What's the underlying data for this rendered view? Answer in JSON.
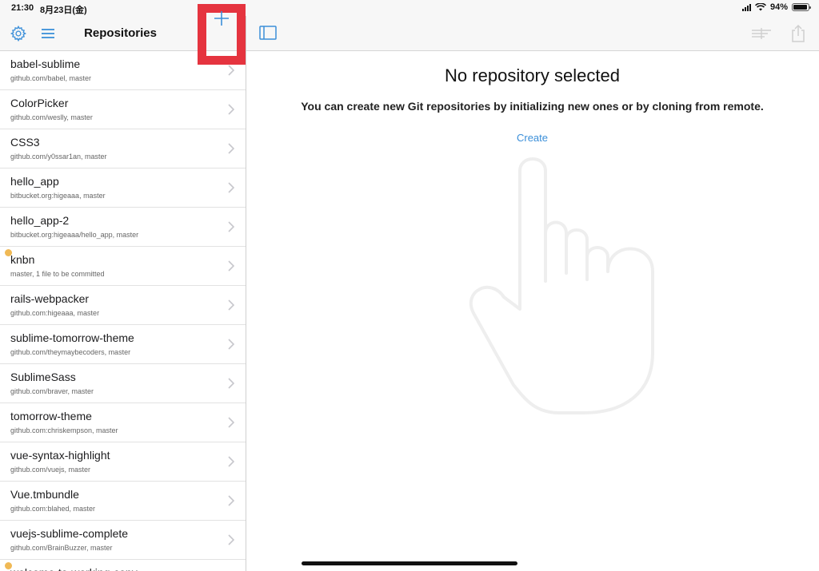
{
  "status_bar": {
    "time": "21:30",
    "date": "8月23日(金)",
    "battery": "94%",
    "battery_level": 0.94
  },
  "left_toolbar": {
    "title": "Repositories",
    "settings_icon": "gear-icon",
    "menu_icon": "menu-icon",
    "add_icon": "plus-icon"
  },
  "right_toolbar": {
    "sidebar_icon": "sidebar-toggle-icon",
    "filter_icon": "filter-icon",
    "share_icon": "share-icon"
  },
  "repositories": [
    {
      "name": "babel-sublime",
      "detail": "github.com/babel, master",
      "modified": false
    },
    {
      "name": "ColorPicker",
      "detail": "github.com/weslly, master",
      "modified": false
    },
    {
      "name": "CSS3",
      "detail": "github.com/y0ssar1an, master",
      "modified": false
    },
    {
      "name": "hello_app",
      "detail": "bitbucket.org:higeaaa, master",
      "modified": false
    },
    {
      "name": "hello_app-2",
      "detail": "bitbucket.org:higeaaa/hello_app, master",
      "modified": false
    },
    {
      "name": "knbn",
      "detail": "master, 1 file to be committed",
      "modified": true
    },
    {
      "name": "rails-webpacker",
      "detail": "github.com:higeaaa, master",
      "modified": false
    },
    {
      "name": "sublime-tomorrow-theme",
      "detail": "github.com/theymaybecoders, master",
      "modified": false
    },
    {
      "name": "SublimeSass",
      "detail": "github.com/braver, master",
      "modified": false
    },
    {
      "name": "tomorrow-theme",
      "detail": "github.com:chriskempson, master",
      "modified": false
    },
    {
      "name": "vue-syntax-highlight",
      "detail": "github.com/vuejs, master",
      "modified": false
    },
    {
      "name": "Vue.tmbundle",
      "detail": "github.com:blahed, master",
      "modified": false
    },
    {
      "name": "vuejs-sublime-complete",
      "detail": "github.com/BrainBuzzer, master",
      "modified": false
    },
    {
      "name": "welcome-to-working-copy",
      "detail": "",
      "modified": true
    }
  ],
  "main": {
    "title": "No repository selected",
    "description": "You can create new Git repositories by initializing new ones or by cloning from remote.",
    "create_label": "Create",
    "illustration_icon": "pointing-hand-icon"
  },
  "colors": {
    "accent": "#3b8fd9",
    "highlight_box": "#e5343f",
    "modified_dot": "#f0b955"
  }
}
